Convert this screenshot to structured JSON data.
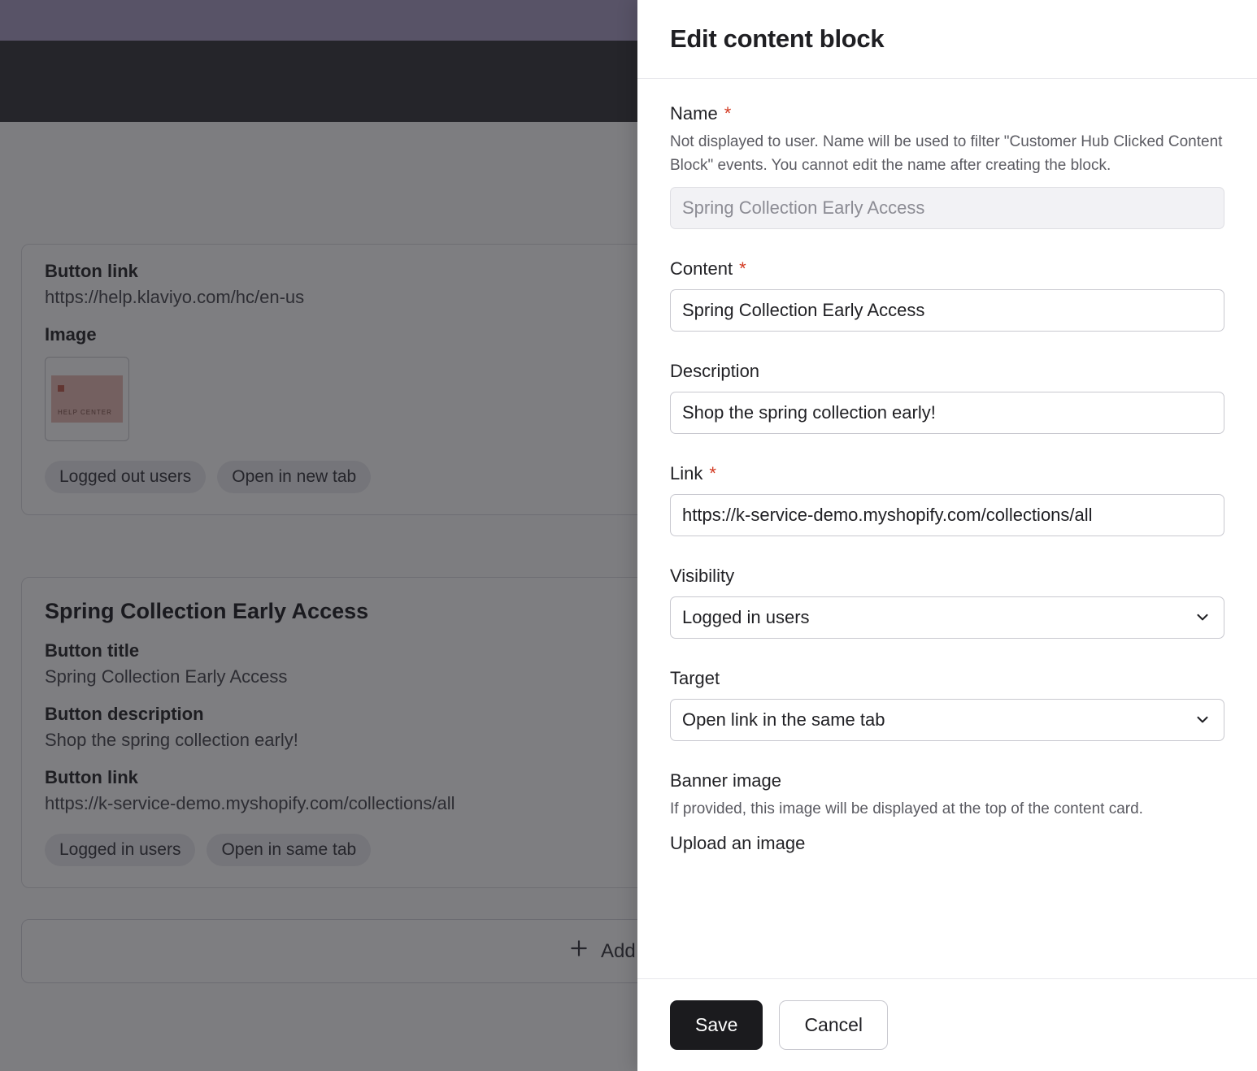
{
  "drawer": {
    "title": "Edit content block",
    "name": {
      "label": "Name",
      "help": "Not displayed to user. Name will be used to filter \"Customer Hub Clicked Content Block\" events. You cannot edit the name after creating the block.",
      "value": "Spring Collection Early Access"
    },
    "content": {
      "label": "Content",
      "value": "Spring Collection Early Access"
    },
    "description": {
      "label": "Description",
      "value": "Shop the spring collection early!"
    },
    "link": {
      "label": "Link",
      "value": "https://k-service-demo.myshopify.com/collections/all"
    },
    "visibility": {
      "label": "Visibility",
      "value": "Logged in users"
    },
    "target": {
      "label": "Target",
      "value": "Open link in the same tab"
    },
    "banner": {
      "label": "Banner image",
      "help": "If provided, this image will be displayed at the top of the content card.",
      "upload_label": "Upload an image"
    },
    "save_label": "Save",
    "cancel_label": "Cancel"
  },
  "background": {
    "block1": {
      "button_link_label": "Button link",
      "button_link_value": "https://help.klaviyo.com/hc/en-us",
      "image_label": "Image",
      "image_caption": "HELP CENTER",
      "pills": {
        "p0": "Logged out users",
        "p1": "Open in new tab"
      }
    },
    "block2": {
      "title": "Spring Collection Early Access",
      "button_title_label": "Button title",
      "button_title_value": "Spring Collection Early Access",
      "button_desc_label": "Button description",
      "button_desc_value": "Shop the spring collection early!",
      "button_link_label": "Button link",
      "button_link_value": "https://k-service-demo.myshopify.com/collections/all",
      "pills": {
        "p0": "Logged in users",
        "p1": "Open in same tab"
      }
    },
    "add_block_label": "Add Block"
  }
}
